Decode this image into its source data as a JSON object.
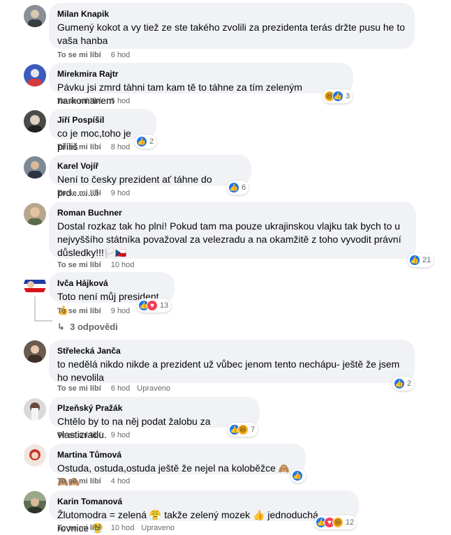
{
  "labels": {
    "like": "To se mi líbí",
    "edited": "Upraveno"
  },
  "colors": {
    "like": "#1877f2",
    "love": "#f33e58",
    "haha": "#f7b125",
    "meta": "#65676b",
    "bubble": "#f0f2f5"
  },
  "comments": [
    {
      "author": "Milan Knapik",
      "text": "Gumený kokot a vy tiež ze ste takého zvolili za prezidenta terás držte pusu he to vaša hanba",
      "time": "6 hod",
      "reactions": [],
      "reaction_count": ""
    },
    {
      "author": "Mirekmira Rajtr",
      "text": "Pávku jsi zmrd tàhni tam kam tě to táhne za tím zeleným narkomanem",
      "time": "5 hod",
      "reactions": [
        "haha",
        "like"
      ],
      "reaction_count": "3"
    },
    {
      "author": "Jiří Pospíšil",
      "text": "co je moc,toho je příliš",
      "time": "8 hod",
      "reactions": [
        "like"
      ],
      "reaction_count": "2"
    },
    {
      "author": "Karel Vojíř",
      "text": "Není to česky prezident ať táhne do prd.........!",
      "time": "9 hod",
      "reactions": [
        "like"
      ],
      "reaction_count": "6"
    },
    {
      "author": "Roman Buchner",
      "text": "Dostal rozkaz tak ho plní! Pokud tam ma pouze ukrajinskou vlajku tak bych to u nejvyššího státníka považoval za velezradu a na okamžitě z toho vyvodit právní důsledky!!!",
      "flag": "🏳️🇨🇿",
      "time": "10 hod",
      "reactions": [
        "like"
      ],
      "reaction_count": "21"
    },
    {
      "author": "Ivča Hájková",
      "text": "Toto není můj president.",
      "emoji": "👍",
      "time": "9 hod",
      "reactions": [
        "like",
        "love"
      ],
      "reaction_count": "13",
      "replies": "3 odpovědi"
    },
    {
      "author": "Střelecká Janča",
      "text": "to nedělá nikdo nikde a prezident už vůbec jenom tento nechápu- ještě že jsem ho nevolila",
      "time": "6 hod",
      "edited": true,
      "reactions": [
        "like"
      ],
      "reaction_count": "2"
    },
    {
      "author": "Plzeňský Pražák",
      "text": "Chtělo by to na něj podat žalobu za vlastizradu.",
      "time": "9 hod",
      "reactions": [
        "like",
        "haha"
      ],
      "reaction_count": "7"
    },
    {
      "author": "Martina Tůmová",
      "text": "Ostuda, ostuda,ostuda ještě že nejel na koloběžce",
      "emoji": "🙈🙈🙈",
      "time": "4 hod",
      "reactions": [
        "like"
      ],
      "reaction_count": ""
    },
    {
      "author": "Karin Tomanová",
      "text": "Žlutomodra = zelená 😤 takže zelený mozek 👍 jednoduchá rovnice 😤",
      "time": "10 hod",
      "edited": true,
      "reactions": [
        "like",
        "love",
        "haha"
      ],
      "reaction_count": "12"
    }
  ]
}
